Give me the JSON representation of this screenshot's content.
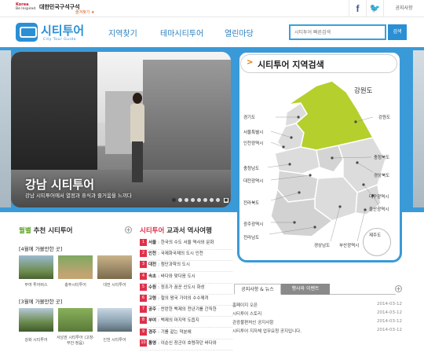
{
  "topbar": {
    "korea_logo_line1": "Korea",
    "korea_logo_line2": "Be Inspired",
    "brand": "대한민국구석구석",
    "favorite": "즐겨찾기 ★",
    "facebook": "f",
    "twitter": "🐦",
    "notice_link": "공지사항"
  },
  "header": {
    "logo_text": "시티투어",
    "logo_sub": "City Tour Guide",
    "nav": [
      "지역찾기",
      "테마시티투어",
      "열린마당"
    ],
    "search_placeholder": "시티투어 빠른검색",
    "search_button": "검색"
  },
  "hero": {
    "title": "강남 시티투어",
    "description": "강남 시티투어에서 열정과 휴식과 즐거움을 느끼다",
    "slide_count": 8,
    "active_slide": 0,
    "stop_glyph": "■"
  },
  "map": {
    "title": "시티투어 지역검색",
    "arrow": ">",
    "highlight_region": "강원도",
    "highlight_color": "#b5cf2d",
    "regions": [
      {
        "name": "경기도"
      },
      {
        "name": "서울특별시"
      },
      {
        "name": "인천광역시"
      },
      {
        "name": "강원도"
      },
      {
        "name": "충청북도"
      },
      {
        "name": "충청남도"
      },
      {
        "name": "경상북도"
      },
      {
        "name": "대전광역시"
      },
      {
        "name": "전라북도"
      },
      {
        "name": "대구광역시"
      },
      {
        "name": "울산광역시"
      },
      {
        "name": "광주광역시"
      },
      {
        "name": "경상남도"
      },
      {
        "name": "전라남도"
      },
      {
        "name": "부산광역시"
      },
      {
        "name": "제주도"
      }
    ]
  },
  "recommend": {
    "title_highlight": "월별",
    "title_rest": " 추천 시티투어",
    "april_head": "[4월에 가볼만한 곳]",
    "april_items": [
      "부여 투어버스",
      "충주시티투어",
      "대전 시티투어"
    ],
    "march_head": "[3월에 가볼만한 곳]",
    "march_items": [
      "강화 시티투어",
      "서남권 시티투어 (고창·부안·정읍)",
      "인천 시티투어"
    ]
  },
  "history": {
    "title_highlight": "시티투어",
    "title_rest": " 교과서 역사여행",
    "items": [
      {
        "num": "1",
        "city": "서울",
        "desc": ": 한국의 수도 서울 역사와 문화"
      },
      {
        "num": "2",
        "city": "인천",
        "desc": ": 국제화국제의 도시 인천"
      },
      {
        "num": "3",
        "city": "대전",
        "desc": ": 첨단과학의 도시"
      },
      {
        "num": "4",
        "city": "속초",
        "desc": ": 바다와 맞다음 도시"
      },
      {
        "num": "5",
        "city": "수원",
        "desc": ": 정조가 꿈꾼 신도시 화성"
      },
      {
        "num": "6",
        "city": "고령",
        "desc": ": 철의 왕국 가야의 수수께끼"
      },
      {
        "num": "7",
        "city": "공주",
        "desc": ": 찬란한 백제의 천년기를 간직한"
      },
      {
        "num": "8",
        "city": "부여",
        "desc": ": 백제의 마지막 도읍지"
      },
      {
        "num": "9",
        "city": "경주",
        "desc": ": 기를 같는 덕분에"
      },
      {
        "num": "10",
        "city": "통영",
        "desc": ": 이순신 장군이 호령하던 바다와"
      }
    ]
  },
  "news": {
    "tab_active": "공지사항 & 뉴스",
    "tab_inactive": "행사와 이벤트",
    "items": [
      {
        "title": "홈페이지 오픈",
        "date": "2014-03-12"
      },
      {
        "title": "시티투어 스토리",
        "date": "2014-03-12"
      },
      {
        "title": "관광불편처신 공지사항",
        "date": "2014-03-12"
      },
      {
        "title": "시티투어 지자체 업무요청 공지입니다.",
        "date": "2014-03-12"
      }
    ]
  },
  "colors": {
    "brand_blue": "#2a8fd4",
    "band_blue": "#3a9ad8",
    "accent_green": "#5aa020",
    "accent_red": "#e0304a"
  }
}
